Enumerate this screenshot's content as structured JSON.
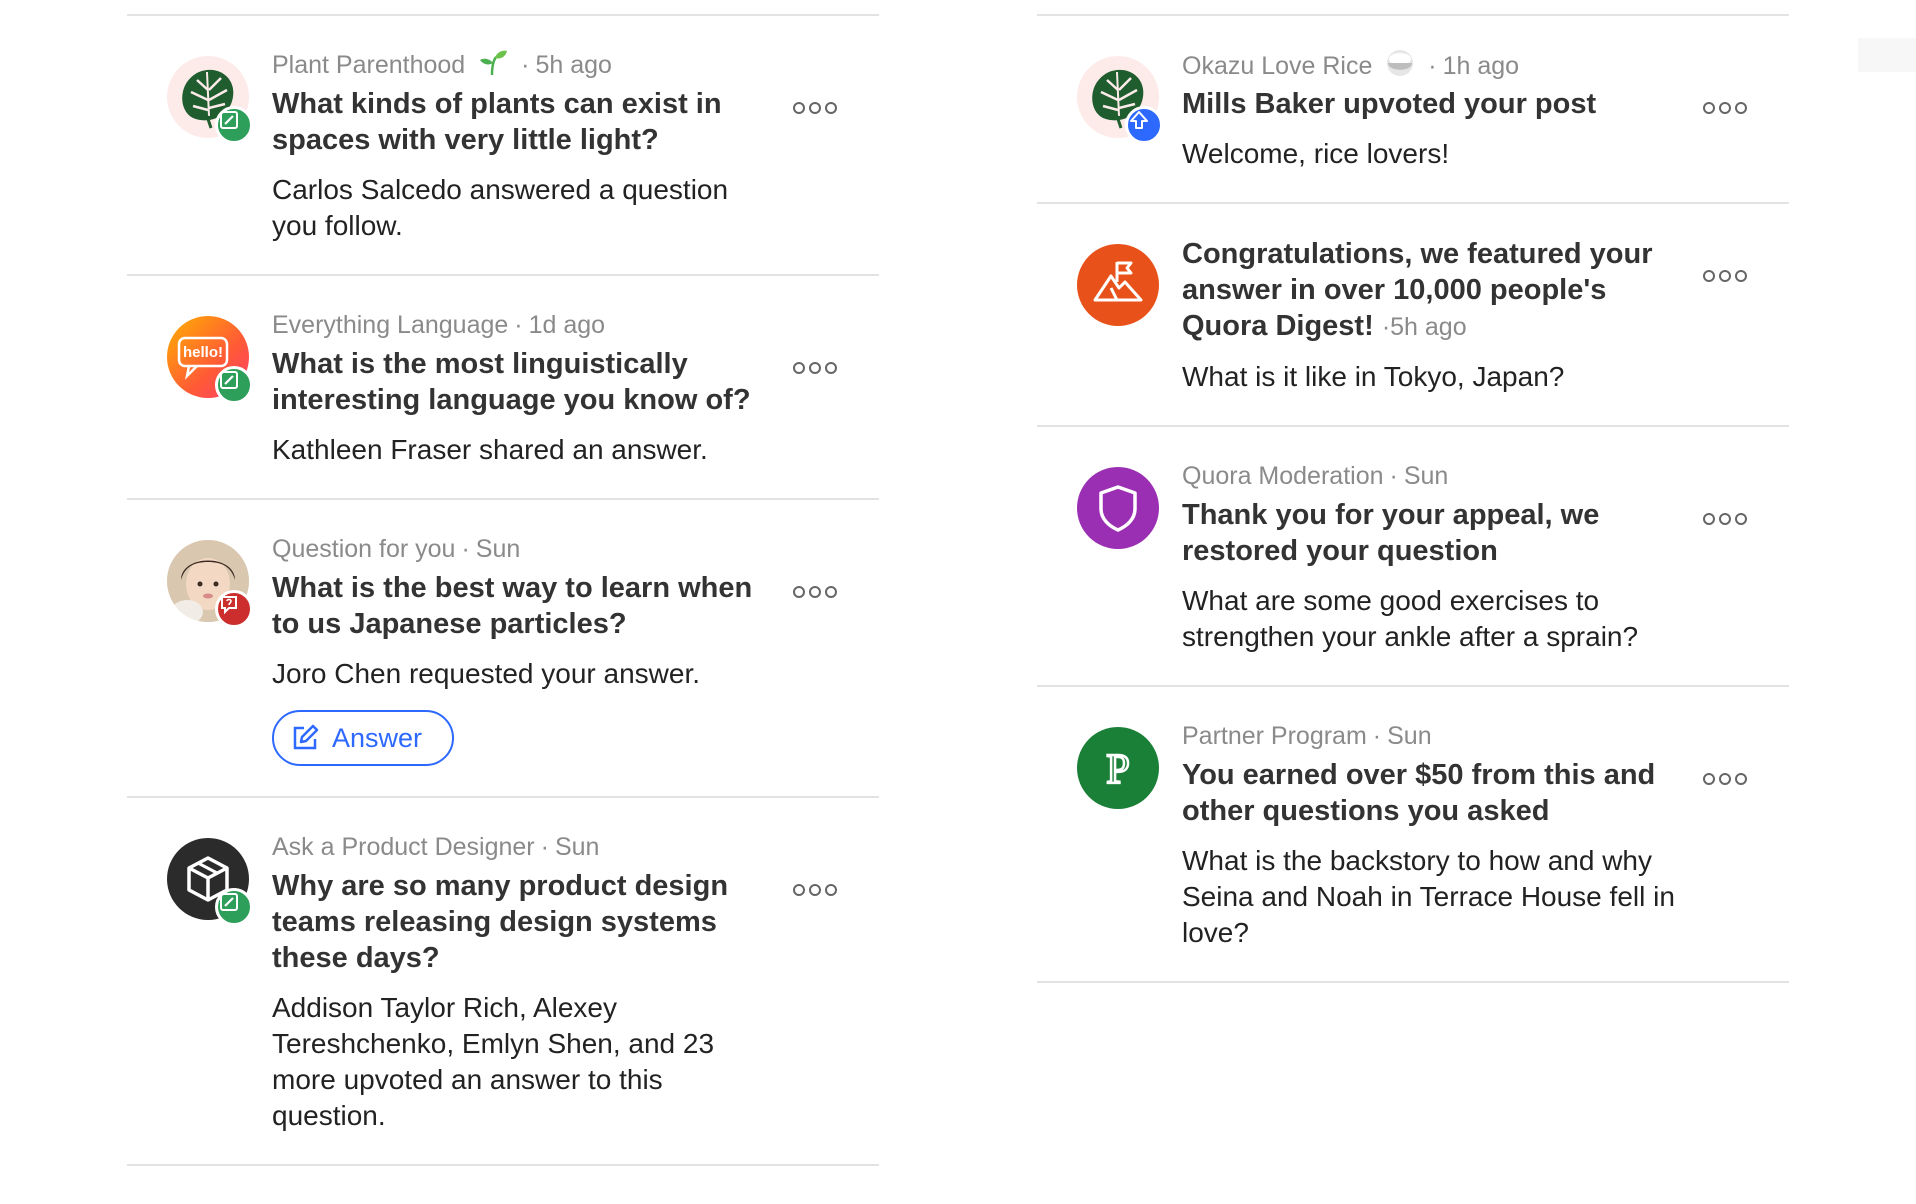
{
  "colors": {
    "badge_green": "#2e9e5b",
    "badge_blue": "#2e69ff",
    "badge_red": "#cc2d2d",
    "accent_blue": "#2e69ff",
    "digest_orange": "#e8521a",
    "moderation_purple": "#9b2fb3",
    "partner_green": "#1a7f37"
  },
  "left_column": [
    {
      "space": "Plant Parenthood",
      "space_icon": "sprout-icon",
      "time": "5h ago",
      "avatar_icon": "monstera-leaf-icon",
      "badge_icon": "edit-pencil-icon",
      "title": "What kinds of plants can exist in spaces with very little light?",
      "description": "Carlos Salcedo answered a question you follow."
    },
    {
      "space": "Everything Language",
      "time": "1d ago",
      "avatar_icon": "hello-speech-bubble-icon",
      "avatar_text": "hello!",
      "badge_icon": "edit-pencil-icon",
      "title": "What is the most linguistically interesting language you know of?",
      "description": "Kathleen Fraser shared an answer."
    },
    {
      "space": "Question for you",
      "time": "Sun",
      "avatar_icon": "user-photo-avatar",
      "badge_icon": "question-bubble-icon",
      "title": "What is the best way to learn when to us Japanese particles?",
      "description": "Joro Chen requested your answer.",
      "button_label": "Answer",
      "button_icon": "edit-pencil-icon"
    },
    {
      "space": "Ask a Product Designer",
      "time": "Sun",
      "avatar_icon": "cube-icon",
      "badge_icon": "edit-pencil-icon",
      "title": "Why are so many product design teams releasing design systems these days?",
      "description": "Addison Taylor Rich, Alexey Tereshchenko, Emlyn Shen, and 23 more upvoted an answer to this question."
    }
  ],
  "right_column": [
    {
      "space": "Okazu Love Rice",
      "space_icon": "rice-bowl-icon",
      "time": "1h ago",
      "avatar_icon": "monstera-leaf-icon",
      "badge_icon": "upvote-arrow-icon",
      "title": "Mills Baker upvoted your post",
      "description": "Welcome, rice lovers!"
    },
    {
      "avatar_icon": "mountain-flag-icon",
      "title": "Congratulations, we featured your answer in over 10,000 people's Quora Digest!",
      "time": "5h ago",
      "description": "What is it like in Tokyo, Japan?"
    },
    {
      "space": "Quora Moderation",
      "time": "Sun",
      "avatar_icon": "shield-icon",
      "title": "Thank you for your appeal, we restored your question",
      "description": "What are some good exercises to strengthen your ankle after a sprain?"
    },
    {
      "space": "Partner Program",
      "time": "Sun",
      "avatar_icon": "partner-p-logo-icon",
      "avatar_text": "P",
      "title": "You earned over $50 from this and other questions you asked",
      "description": "What is the backstory to how and why Seina and Noah in Terrace House fell in love?"
    }
  ]
}
